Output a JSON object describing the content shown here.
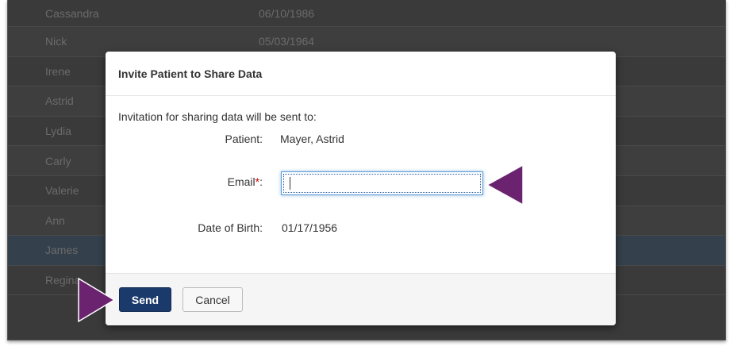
{
  "background_rows": [
    {
      "name": "Cassandra",
      "dob": "06/10/1986"
    },
    {
      "name": "Nick",
      "dob": "05/03/1964"
    },
    {
      "name": "Irene",
      "dob": ""
    },
    {
      "name": "Astrid",
      "dob": ""
    },
    {
      "name": "Lydia",
      "dob": ""
    },
    {
      "name": "Carly",
      "dob": ""
    },
    {
      "name": "Valerie",
      "dob": ""
    },
    {
      "name": "Ann",
      "dob": ""
    },
    {
      "name": "James",
      "dob": ""
    },
    {
      "name": "Regina",
      "dob": ""
    }
  ],
  "modal": {
    "title": "Invite Patient to Share Data",
    "intro": "Invitation for sharing data will be sent to:",
    "patient_label": "Patient:",
    "patient_value": "Mayer, Astrid",
    "email_label": "Email",
    "email_required_mark": "*",
    "email_label_colon": ":",
    "email_value": "",
    "dob_label": "Date of Birth:",
    "dob_value": "01/17/1956",
    "send_label": "Send",
    "cancel_label": "Cancel"
  },
  "colors": {
    "annotation_arrow": "#6b2370",
    "primary_button": "#1a3a6b",
    "overlay": "#3a3a3a"
  },
  "annotations": [
    "arrow-pointing-to-email-field",
    "arrow-pointing-to-send-button"
  ]
}
